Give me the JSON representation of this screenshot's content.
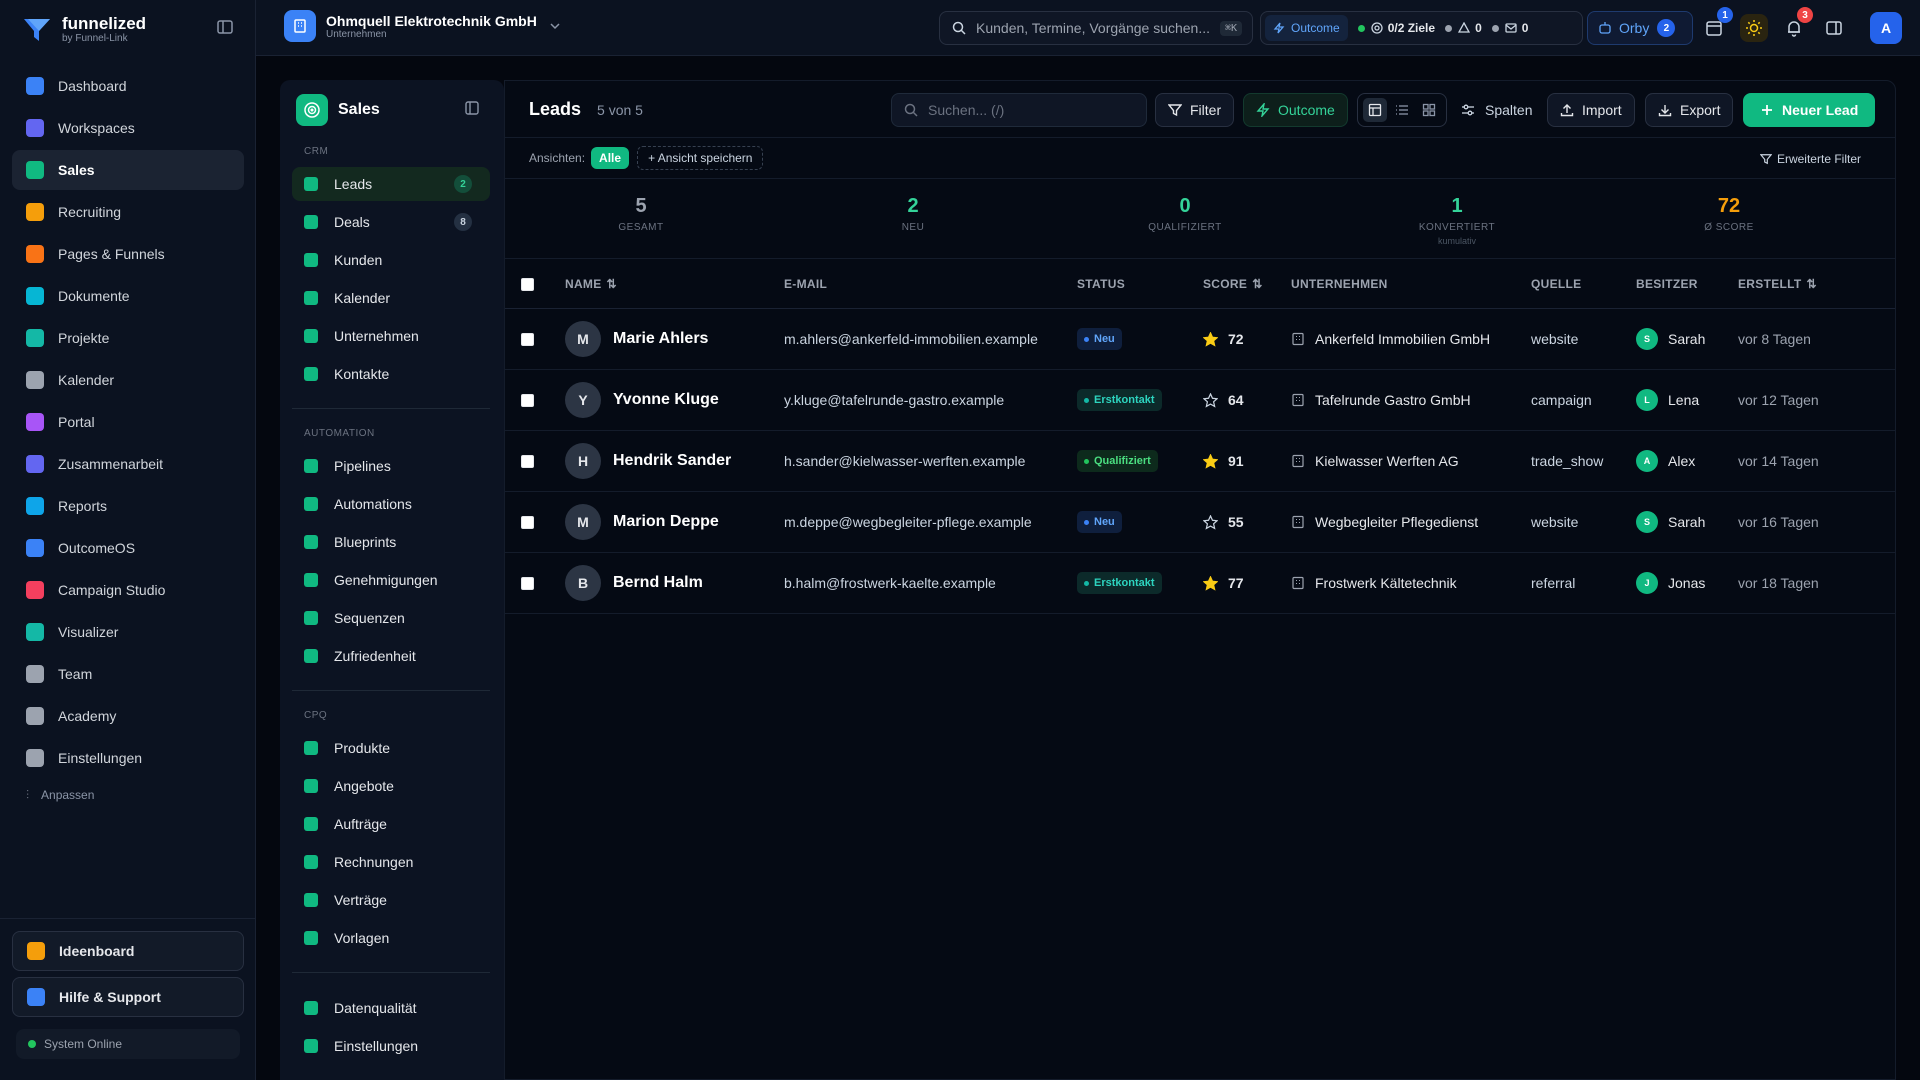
{
  "brand": {
    "name": "funnelized",
    "sub": "by Funnel-Link"
  },
  "nav": [
    {
      "label": "Dashboard",
      "icon": "dashboard-icon",
      "color": "#3b82f6"
    },
    {
      "label": "Workspaces",
      "icon": "workspaces-icon",
      "color": "#6366f1"
    },
    {
      "label": "Sales",
      "icon": "sales-icon",
      "color": "#10b981",
      "active": true
    },
    {
      "label": "Recruiting",
      "icon": "recruiting-icon",
      "color": "#f59e0b"
    },
    {
      "label": "Pages & Funnels",
      "icon": "funnel-icon",
      "color": "#f97316"
    },
    {
      "label": "Dokumente",
      "icon": "document-icon",
      "color": "#06b6d4"
    },
    {
      "label": "Projekte",
      "icon": "projects-icon",
      "color": "#14b8a6"
    },
    {
      "label": "Kalender",
      "icon": "calendar-icon",
      "color": "#9ca3af"
    },
    {
      "label": "Portal",
      "icon": "portal-icon",
      "color": "#a855f7"
    },
    {
      "label": "Zusammenarbeit",
      "icon": "collaboration-icon",
      "color": "#6366f1"
    },
    {
      "label": "Reports",
      "icon": "reports-icon",
      "color": "#0ea5e9"
    },
    {
      "label": "OutcomeOS",
      "icon": "outcome-icon",
      "color": "#3b82f6"
    },
    {
      "label": "Campaign Studio",
      "icon": "flag-icon",
      "color": "#f43f5e"
    },
    {
      "label": "Visualizer",
      "icon": "visualizer-icon",
      "color": "#14b8a6"
    },
    {
      "label": "Team",
      "icon": "team-icon",
      "color": "#9ca3af"
    },
    {
      "label": "Academy",
      "icon": "academy-icon",
      "color": "#9ca3af"
    },
    {
      "label": "Einstellungen",
      "icon": "settings-icon",
      "color": "#9ca3af"
    }
  ],
  "nav_customize": "Anpassen",
  "sidebar_bottom": {
    "ideas": "Ideenboard",
    "help": "Hilfe & Support",
    "status": "System Online"
  },
  "topbar": {
    "company_name": "Ohmquell Elektrotechnik GmbH",
    "company_type": "Unternehmen",
    "search_placeholder": "Kunden, Termine, Vorgänge suchen...",
    "search_shortcut": "⌘K",
    "outcome": "Outcome",
    "goals": "0/2 Ziele",
    "warnings": "0",
    "messages": "0",
    "orby": "Orby",
    "orby_badge": "2",
    "calendar_badge": "1",
    "notification_badge": "3",
    "user_initial": "A"
  },
  "panel": {
    "title": "Sales",
    "crm_label": "CRM",
    "crm": [
      {
        "label": "Leads",
        "badge": "2",
        "color": "#10b981",
        "active": true
      },
      {
        "label": "Deals",
        "badge": "8",
        "color": "#10b981"
      },
      {
        "label": "Kunden",
        "color": "#10b981"
      },
      {
        "label": "Kalender",
        "color": "#10b981"
      },
      {
        "label": "Unternehmen",
        "color": "#10b981"
      },
      {
        "label": "Kontakte",
        "color": "#10b981"
      }
    ],
    "automation_label": "AUTOMATION",
    "automation": [
      {
        "label": "Pipelines",
        "color": "#10b981"
      },
      {
        "label": "Automations",
        "color": "#10b981"
      },
      {
        "label": "Blueprints",
        "color": "#10b981"
      },
      {
        "label": "Genehmigungen",
        "color": "#10b981"
      },
      {
        "label": "Sequenzen",
        "color": "#10b981"
      },
      {
        "label": "Zufriedenheit",
        "color": "#10b981"
      }
    ],
    "cpq_label": "CPQ",
    "cpq": [
      {
        "label": "Produkte",
        "color": "#10b981"
      },
      {
        "label": "Angebote",
        "color": "#10b981"
      },
      {
        "label": "Aufträge",
        "color": "#10b981"
      },
      {
        "label": "Rechnungen",
        "color": "#10b981"
      },
      {
        "label": "Verträge",
        "color": "#10b981"
      },
      {
        "label": "Vorlagen",
        "color": "#10b981"
      }
    ],
    "extra": [
      {
        "label": "Datenqualität",
        "color": "#10b981"
      },
      {
        "label": "Einstellungen",
        "color": "#10b981"
      }
    ]
  },
  "main": {
    "title": "Leads",
    "count": "5 von 5",
    "search_placeholder": "Suchen... (/)",
    "filter": "Filter",
    "outcome": "Outcome",
    "columns": "Spalten",
    "import": "Import",
    "export": "Export",
    "new_lead": "Neuer Lead",
    "views_label": "Ansichten:",
    "view_all": "Alle",
    "save_view": "Ansicht speichern",
    "advanced_filter": "Erweiterte Filter"
  },
  "stats": [
    {
      "value": "5",
      "label": "GESAMT",
      "color": "#9ca3af"
    },
    {
      "value": "2",
      "label": "NEU",
      "color": "#34d399"
    },
    {
      "value": "0",
      "label": "QUALIFIZIERT",
      "color": "#34d399"
    },
    {
      "value": "1",
      "label": "KONVERTIERT",
      "sub": "kumulativ",
      "color": "#34d399"
    },
    {
      "value": "72",
      "label": "Ø SCORE",
      "color": "#f59e0b"
    }
  ],
  "columns": {
    "name": "NAME",
    "email": "E-MAIL",
    "status": "STATUS",
    "score": "SCORE",
    "company": "UNTERNEHMEN",
    "source": "QUELLE",
    "owner": "BESITZER",
    "created": "ERSTELLT"
  },
  "leads": [
    {
      "initial": "M",
      "name": "Marie Ahlers",
      "email": "m.ahlers@ankerfeld-immobilien.example",
      "status": "Neu",
      "status_kind": "new",
      "score": "72",
      "starred": true,
      "company": "Ankerfeld Immobilien GmbH",
      "source": "website",
      "owner_initial": "S",
      "owner": "Sarah",
      "created": "vor 8 Tagen"
    },
    {
      "initial": "Y",
      "name": "Yvonne Kluge",
      "email": "y.kluge@tafelrunde-gastro.example",
      "status": "Erstkontakt",
      "status_kind": "contact",
      "score": "64",
      "starred": false,
      "company": "Tafelrunde Gastro GmbH",
      "source": "campaign",
      "owner_initial": "L",
      "owner": "Lena",
      "created": "vor 12 Tagen"
    },
    {
      "initial": "H",
      "name": "Hendrik Sander",
      "email": "h.sander@kielwasser-werften.example",
      "status": "Qualifiziert",
      "status_kind": "qualified",
      "score": "91",
      "starred": true,
      "company": "Kielwasser Werften AG",
      "source": "trade_show",
      "owner_initial": "A",
      "owner": "Alex",
      "created": "vor 14 Tagen"
    },
    {
      "initial": "M",
      "name": "Marion Deppe",
      "email": "m.deppe@wegbegleiter-pflege.example",
      "status": "Neu",
      "status_kind": "new",
      "score": "55",
      "starred": false,
      "company": "Wegbegleiter Pflegedienst",
      "source": "website",
      "owner_initial": "S",
      "owner": "Sarah",
      "created": "vor 16 Tagen"
    },
    {
      "initial": "B",
      "name": "Bernd Halm",
      "email": "b.halm@frostwerk-kaelte.example",
      "status": "Erstkontakt",
      "status_kind": "contact",
      "score": "77",
      "starred": true,
      "company": "Frostwerk Kältetechnik",
      "source": "referral",
      "owner_initial": "J",
      "owner": "Jonas",
      "created": "vor 18 Tagen"
    }
  ],
  "colors": {
    "accent": "#10b981",
    "status_new": "#3b82f6",
    "status_contact": "#14b8a6",
    "status_qualified": "#22c55e",
    "star": "#facc15"
  }
}
